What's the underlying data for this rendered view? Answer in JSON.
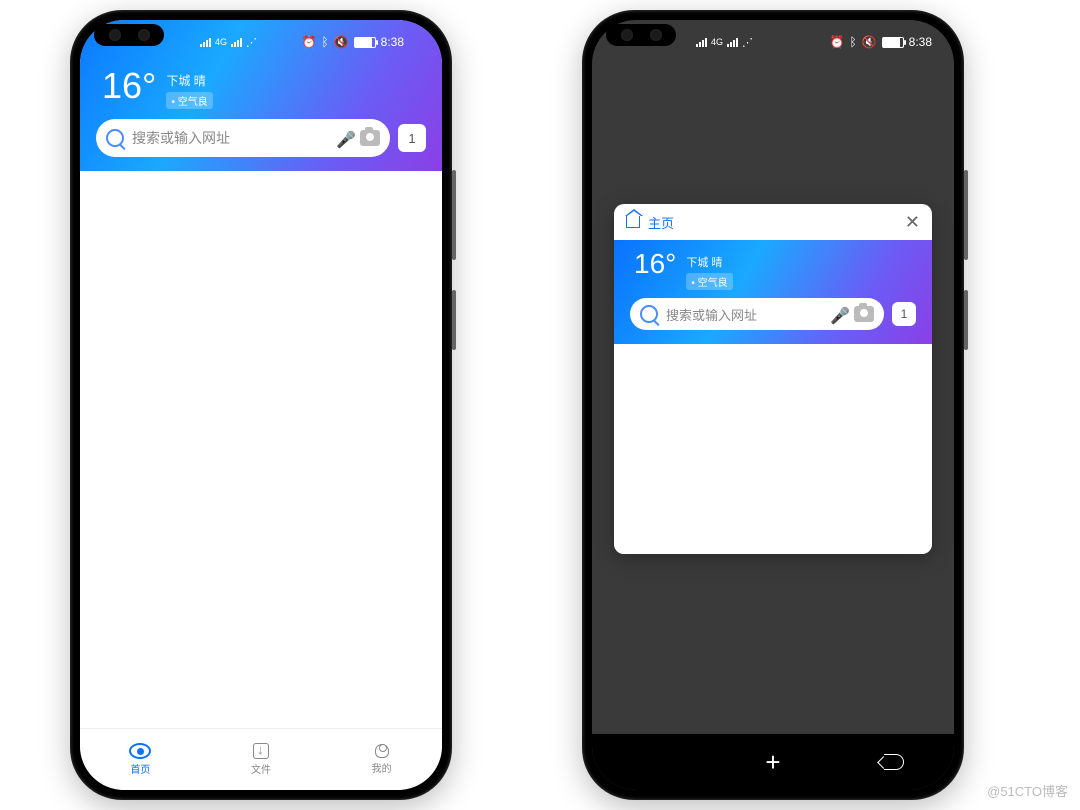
{
  "status": {
    "time": "8:38"
  },
  "weather": {
    "temp": "16°",
    "city_cond": "下城 晴",
    "aq": "• 空气良"
  },
  "search": {
    "placeholder": "搜索或输入网址"
  },
  "tab_count": "1",
  "bottom_nav": {
    "home": "首页",
    "files": "文件",
    "mine": "我的"
  },
  "tab_switcher": {
    "title": "主页",
    "add": "+",
    "close": "✕"
  },
  "watermark": "@51CTO博客"
}
